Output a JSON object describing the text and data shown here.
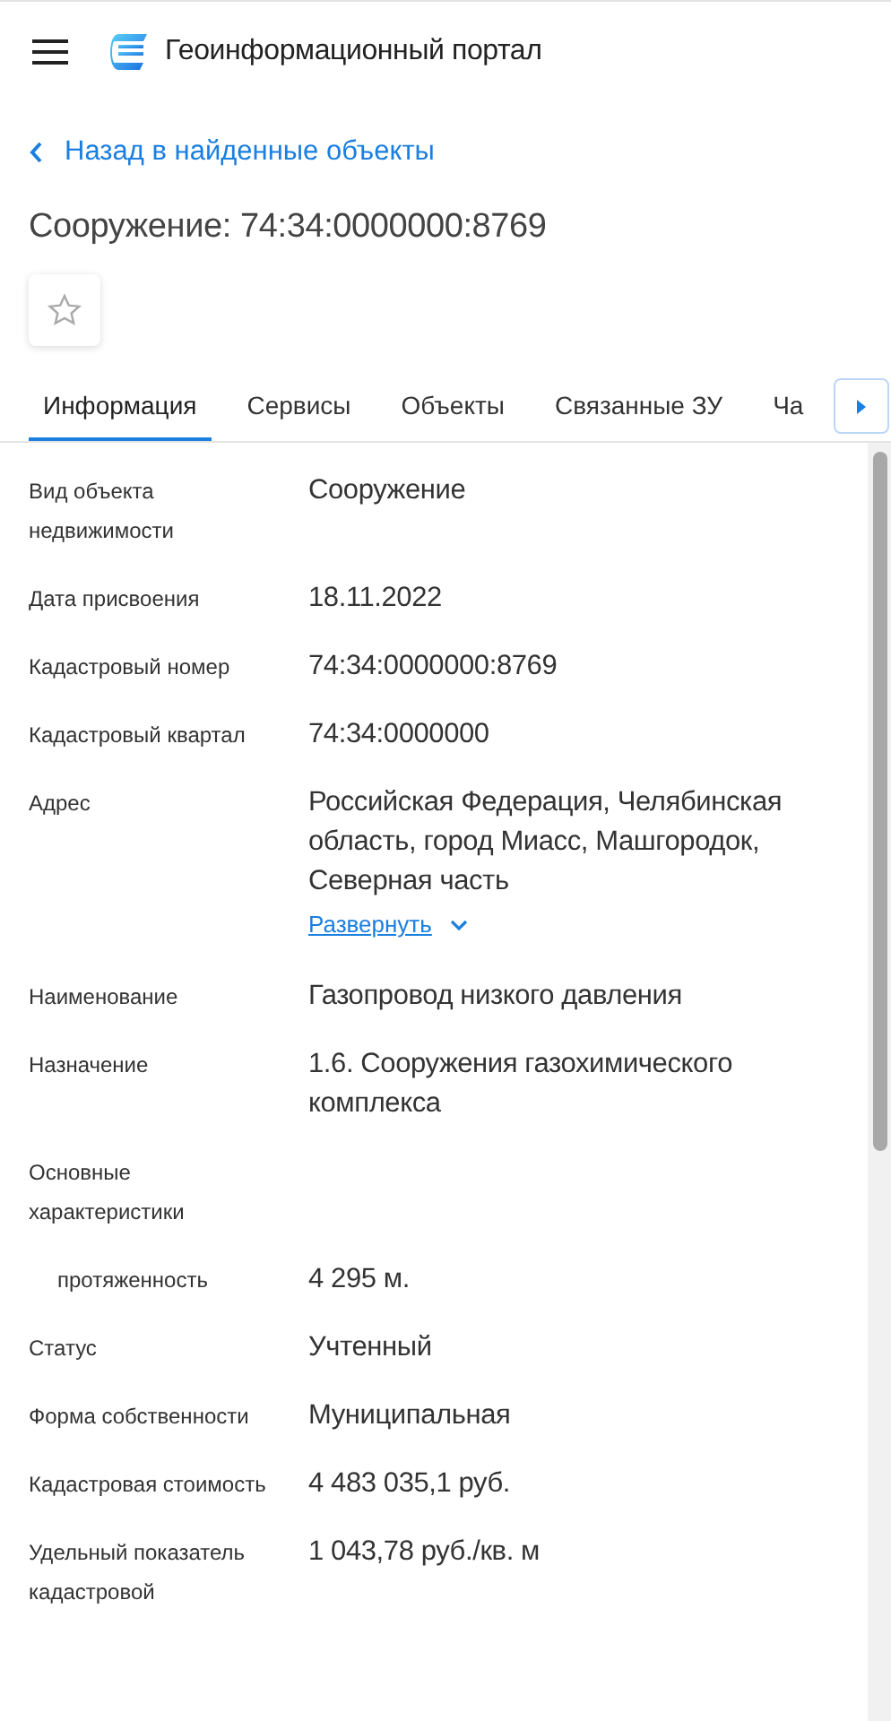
{
  "header": {
    "title": "Геоинформационный портал"
  },
  "back_link": "Назад в найденные объекты",
  "title": "Сооружение: 74:34:0000000:8769",
  "favorite": {
    "checked": false
  },
  "tabs": [
    {
      "label": "Информация",
      "selected": true
    },
    {
      "label": "Сервисы",
      "selected": false
    },
    {
      "label": "Объекты",
      "selected": false
    },
    {
      "label": "Связанные ЗУ",
      "selected": false
    },
    {
      "label": "Ча",
      "selected": false
    }
  ],
  "fields": [
    {
      "kind": "field",
      "label": "Вид объекта недвижимости",
      "value": "Сооружение"
    },
    {
      "kind": "field",
      "label": "Дата присвоения",
      "value": "18.11.2022"
    },
    {
      "kind": "field",
      "label": "Кадастровый номер",
      "value": "74:34:0000000:8769"
    },
    {
      "kind": "field",
      "label": "Кадастровый квартал",
      "value": "74:34:0000000"
    },
    {
      "kind": "field",
      "label": "Адрес",
      "value": "Российская Федерация, Челябинская область, город Миасс, Машгородок, Северная часть",
      "expand_link": "Развернуть"
    },
    {
      "kind": "field",
      "label": "Наименование",
      "value": "Газопровод низкого давления"
    },
    {
      "kind": "field",
      "label": "Назначение",
      "value": "1.6. Сооружения газохимического комплекса"
    },
    {
      "kind": "group",
      "label": "Основные характеристики"
    },
    {
      "kind": "subfield",
      "label": "протяженность",
      "value": "4 295 м."
    },
    {
      "kind": "field",
      "label": "Статус",
      "value": "Учтенный"
    },
    {
      "kind": "field",
      "label": "Форма собственности",
      "value": "Муниципальная"
    },
    {
      "kind": "field",
      "label": "Кадастровая стоимость",
      "value": "4 483 035,1 руб."
    },
    {
      "kind": "field",
      "label": "Удельный показатель кадастровой",
      "value": "1 043,78 руб./кв. м"
    }
  ]
}
